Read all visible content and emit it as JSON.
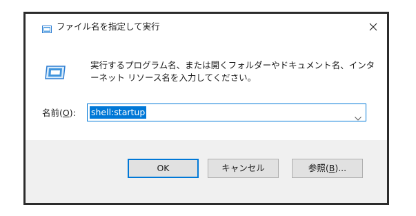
{
  "window": {
    "title": "ファイル名を指定して実行",
    "title_icon": "run-icon",
    "close_icon": "close-icon"
  },
  "description": "実行するプログラム名、または開くフォルダーやドキュメント名、インターネット リソース名を入力してください。",
  "open_field": {
    "label_prefix": "名前(",
    "label_accel": "O",
    "label_suffix": "):",
    "value": "shell:startup",
    "dropdown_icon": "chevron-down-icon"
  },
  "buttons": {
    "ok": "OK",
    "cancel": "キャンセル",
    "browse_prefix": "参照(",
    "browse_accel": "B",
    "browse_suffix": ")..."
  },
  "colors": {
    "accent": "#0078d7",
    "footer_bg": "#f0f0f0",
    "frame": "#2b2b2b"
  }
}
